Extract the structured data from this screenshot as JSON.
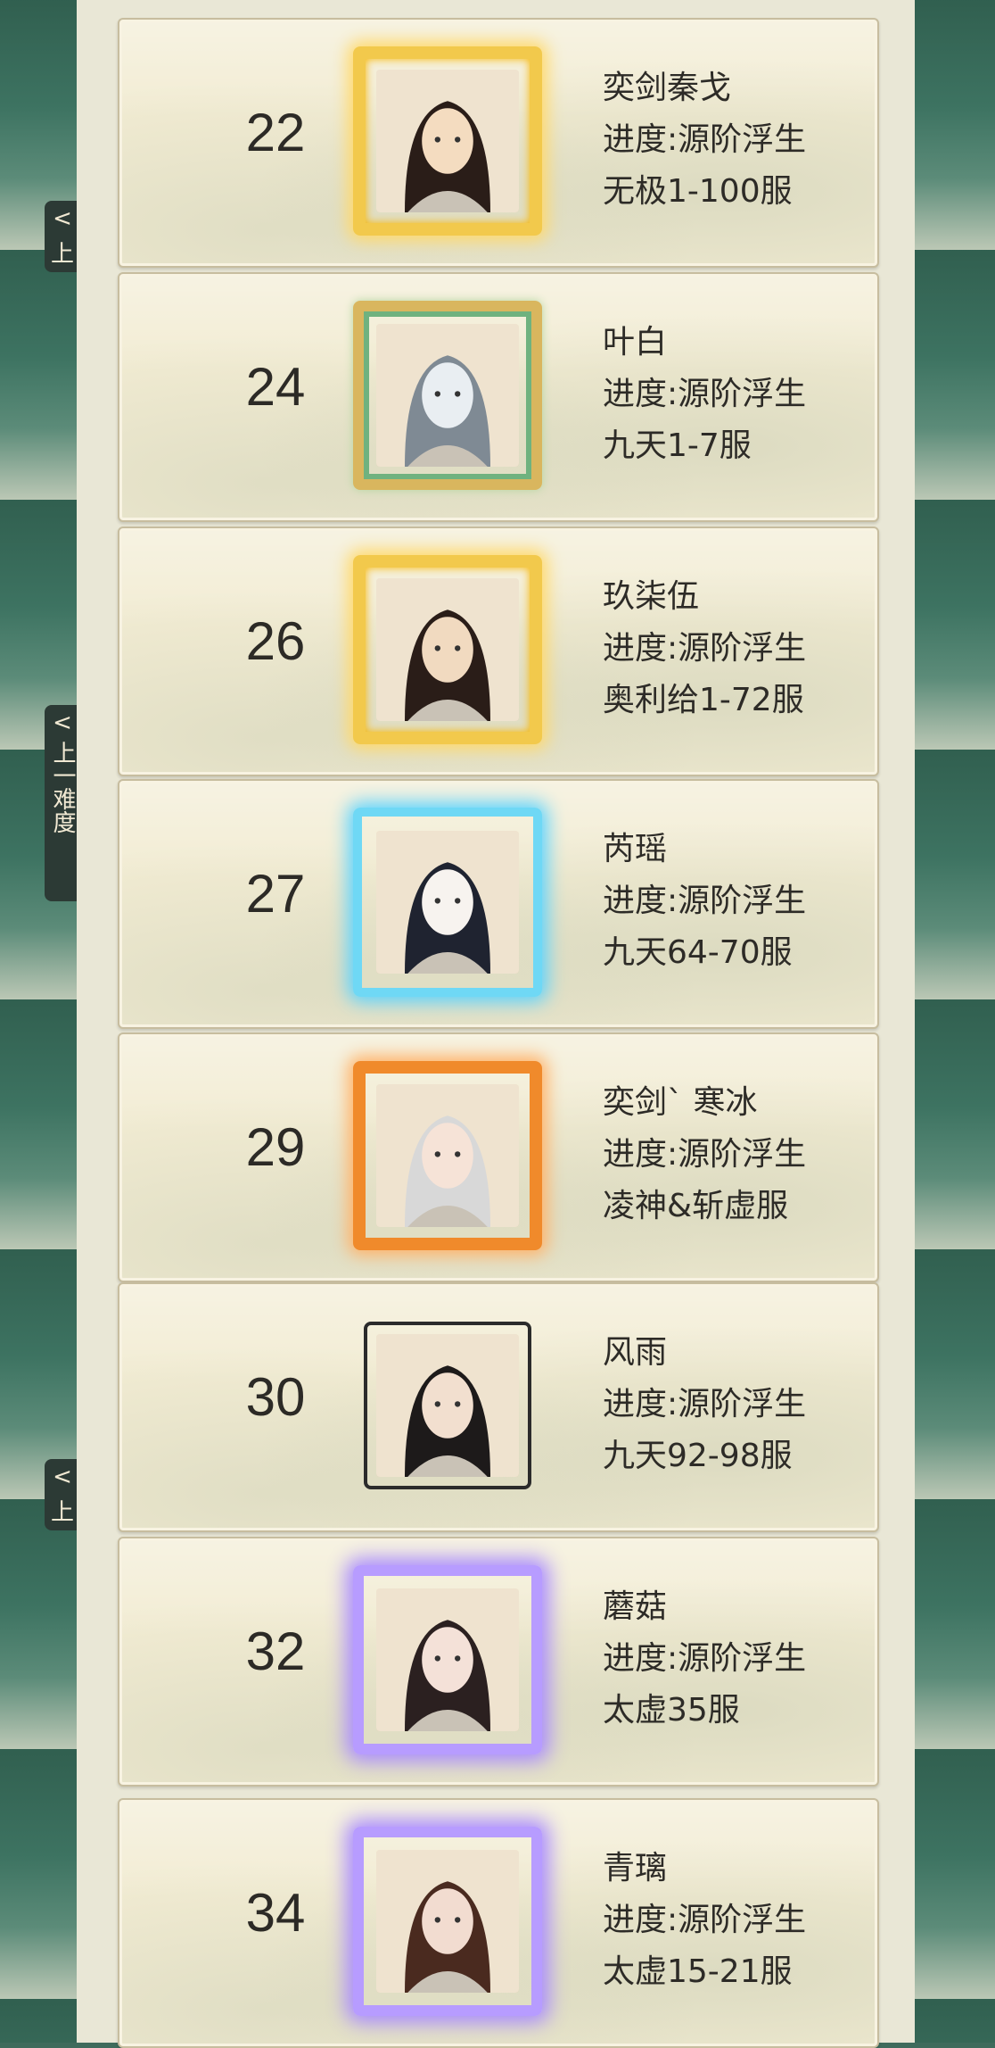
{
  "side_buttons": [
    {
      "label": "<",
      "sub": "上"
    },
    {
      "label": "<",
      "sub": "上一难度"
    },
    {
      "label": "<",
      "sub": "上"
    }
  ],
  "entries": [
    {
      "rank": "22",
      "name": "奕剑秦戈",
      "progress": "进度:源阶浮生",
      "server": "无极1-100服",
      "frame": "gold",
      "icon": "portrait-male-icon",
      "skin": "#f4dcc0",
      "hair": "#2a1d18"
    },
    {
      "rank": "24",
      "name": "叶白",
      "progress": "进度:源阶浮生",
      "server": "九天1-7服",
      "frame": "jade",
      "icon": "portrait-dragon-mask-icon",
      "skin": "#e9eef2",
      "hair": "#7f8a94"
    },
    {
      "rank": "26",
      "name": "玖柒伍",
      "progress": "进度:源阶浮生",
      "server": "奥利给1-72服",
      "frame": "gold",
      "icon": "portrait-masked-male-icon",
      "skin": "#f1dac0",
      "hair": "#2a1d18"
    },
    {
      "rank": "27",
      "name": "芮瑶",
      "progress": "进度:源阶浮生",
      "server": "九天64-70服",
      "frame": "blue",
      "icon": "portrait-fox-mask-icon",
      "skin": "#f7f3ef",
      "hair": "#1f2330"
    },
    {
      "rank": "29",
      "name": "奕剑ˋ 寒冰",
      "progress": "进度:源阶浮生",
      "server": "凌神&斩虚服",
      "frame": "fire",
      "icon": "portrait-female-icon",
      "skin": "#f6e3d7",
      "hair": "#d8d8d8"
    },
    {
      "rank": "30",
      "name": "风雨",
      "progress": "进度:源阶浮生",
      "server": "九天92-98服",
      "frame": "plain",
      "icon": "portrait-male-icon",
      "skin": "#f2dfcf",
      "hair": "#1d1a1a"
    },
    {
      "rank": "32",
      "name": "蘑菇",
      "progress": "进度:源阶浮生",
      "server": "太虚35服",
      "frame": "purple",
      "icon": "portrait-female-icon",
      "skin": "#f4e1d8",
      "hair": "#2b2020"
    },
    {
      "rank": "34",
      "name": "青璃",
      "progress": "进度:源阶浮生",
      "server": "太虚15-21服",
      "frame": "purple",
      "icon": "portrait-female-icon",
      "skin": "#f2dcd0",
      "hair": "#4a2a1f"
    }
  ]
}
